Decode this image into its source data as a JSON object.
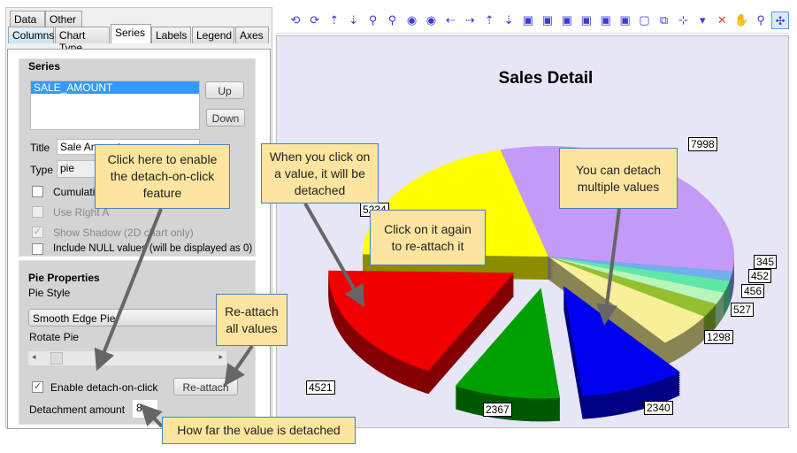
{
  "tabs_row1": [
    "Data",
    "Other"
  ],
  "tabs_row2": [
    "Columns",
    "Chart Type",
    "Series",
    "Labels",
    "Legend",
    "Axes"
  ],
  "selected_tab": "Series",
  "series_group": {
    "title": "Series",
    "list": [
      "SALE_AMOUNT"
    ],
    "up": "Up",
    "down": "Down",
    "title_label": "Title",
    "title_value": "Sale Amount",
    "type_label": "Type",
    "type_value": "pie",
    "cumulative": "Cumulative",
    "use_right_axis": "Use Right A",
    "show_shadow": "Show Shadow (2D chart only)",
    "include_null": "Include NULL values (will be displayed as 0)"
  },
  "pie_group": {
    "title": "Pie Properties",
    "style_label": "Pie Style",
    "style_value": "Smooth Edge Pie",
    "rotate_label": "Rotate Pie",
    "rotate_value": 0.07,
    "enable_detach": "Enable detach-on-click",
    "enable_detach_checked": true,
    "reattach": "Re-attach",
    "detach_amount_label": "Detachment amount",
    "detach_amount": "8"
  },
  "toolbar_icons": [
    "rotate-left-icon",
    "rotate-right-icon",
    "rotate-up-icon",
    "rotate-down-icon",
    "zoom-in-icon",
    "zoom-out-icon",
    "view-left-icon",
    "view-right-icon",
    "move-left-icon",
    "move-right-icon",
    "move-up-icon",
    "move-down-icon",
    "depth-increase-icon",
    "depth-decrease-icon",
    "width-increase-icon",
    "width-decrease-icon",
    "height-increase-icon",
    "height-decrease-icon",
    "3d-box-icon",
    "2d-box-icon",
    "axis-icon",
    "dropdown-icon",
    "cancel-icon",
    "hand-icon",
    "zoom-select-icon",
    "pointer-move-icon"
  ],
  "chart_data": {
    "type": "pie",
    "title": "Sales Detail",
    "values": [
      7998,
      345,
      452,
      456,
      527,
      1298,
      2340,
      2367,
      4521,
      5234
    ],
    "labels": [
      "7998",
      "345",
      "452",
      "456",
      "527",
      "1298",
      "2340",
      "2367",
      "4521",
      "5234"
    ],
    "colors": [
      "#c49af8",
      "#70b0f0",
      "#5ee8a8",
      "#b8f5b8",
      "#94c030",
      "#f8f098",
      "#0000f0",
      "#00a000",
      "#f00000",
      "#ffff00"
    ],
    "detached": [
      false,
      false,
      false,
      false,
      false,
      false,
      true,
      true,
      true,
      false
    ]
  },
  "callouts": {
    "enable": "Click here to enable the detach-on-click feature",
    "click_value": "When you click on a value, it will be detached",
    "click_again": "Click on it again to re-attach it",
    "multiple": "You can detach multiple values",
    "reattach_all": "Re-attach all values",
    "how_far": "How far the value is detached"
  }
}
